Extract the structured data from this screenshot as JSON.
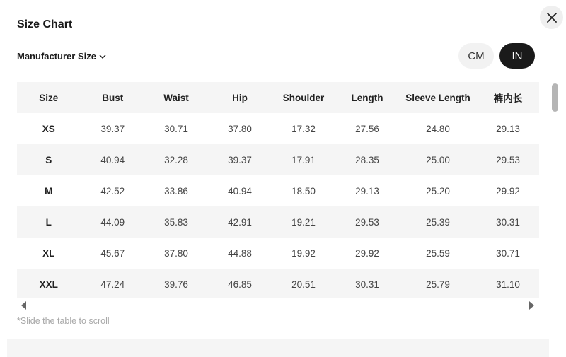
{
  "title": "Size Chart",
  "close_icon": "close-icon",
  "size_type": {
    "label": "Manufacturer Size",
    "icon": "chevron-down-icon"
  },
  "units": [
    {
      "label": "CM",
      "active": false
    },
    {
      "label": "IN",
      "active": true
    }
  ],
  "table": {
    "headers": [
      "Size",
      "Bust",
      "Waist",
      "Hip",
      "Shoulder",
      "Length",
      "Sleeve Length",
      "裤内长"
    ],
    "rows": [
      [
        "XS",
        "39.37",
        "30.71",
        "37.80",
        "17.32",
        "27.56",
        "24.80",
        "29.13"
      ],
      [
        "S",
        "40.94",
        "32.28",
        "39.37",
        "17.91",
        "28.35",
        "25.00",
        "29.53"
      ],
      [
        "M",
        "42.52",
        "33.86",
        "40.94",
        "18.50",
        "29.13",
        "25.20",
        "29.92"
      ],
      [
        "L",
        "44.09",
        "35.83",
        "42.91",
        "19.21",
        "29.53",
        "25.39",
        "30.31"
      ],
      [
        "XL",
        "45.67",
        "37.80",
        "44.88",
        "19.92",
        "29.92",
        "25.59",
        "30.71"
      ],
      [
        "XXL",
        "47.24",
        "39.76",
        "46.85",
        "20.51",
        "30.31",
        "25.79",
        "31.10"
      ]
    ]
  },
  "scroll_hint": "*Slide the table to scroll",
  "colors": {
    "active_toggle": "#1a1a1a",
    "stripe": "#f5f5f5",
    "hint": "#a8a8a8"
  }
}
